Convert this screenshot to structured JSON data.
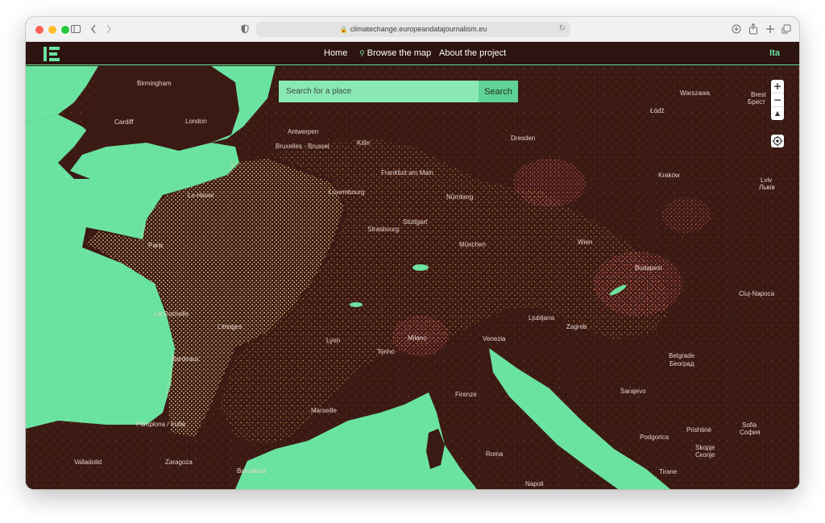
{
  "browser": {
    "url": "climatechange.europeandatajournalism.eu"
  },
  "nav": {
    "logo_text": "EDJNet",
    "links": [
      "Home",
      "Browse the map",
      "About the project"
    ],
    "language": "Ita"
  },
  "search": {
    "placeholder": "Search for a place",
    "button_label": "Search"
  },
  "map_controls": {
    "zoom_in": "+",
    "zoom_out": "−",
    "compass": "▲"
  },
  "colors": {
    "land": "#3b1a14",
    "sea": "#6be3a0",
    "accent": "#6be3a0",
    "warm_dots": "#e09040",
    "pale_dots": "#f2d38a",
    "pink_dots": "#d95568"
  },
  "map": {
    "cities": [
      "Birmingham",
      "London",
      "Cardiff",
      "Antwerpen",
      "Bruxelles - Brussel",
      "Köln",
      "Dresden",
      "Warszawa",
      "Łódź",
      "Brest",
      "Брест",
      "Frankfurt am Main",
      "Kraków",
      "Lviv",
      "Львів",
      "Le Havre",
      "Luxembourg",
      "Nürnberg",
      "Stuttgart",
      "Strasbourg",
      "Paris",
      "München",
      "Wien",
      "Budapest",
      "Cluj-Napoca",
      "La Rochelle",
      "Limoges",
      "Ljubljana",
      "Zagreb",
      "Bordeaux",
      "Milano",
      "Venezia",
      "Lyon",
      "Torino",
      "Belgrade",
      "Београд",
      "Marseille",
      "Firenze",
      "Sarajevo",
      "Pamplona / Iruña",
      "Zaragoza",
      "Barcelona",
      "Valladolid",
      "Roma",
      "Podgorica",
      "Prishtinë",
      "Skopje",
      "Скопје",
      "Sofia",
      "София",
      "Tirane",
      "Napoli"
    ]
  }
}
